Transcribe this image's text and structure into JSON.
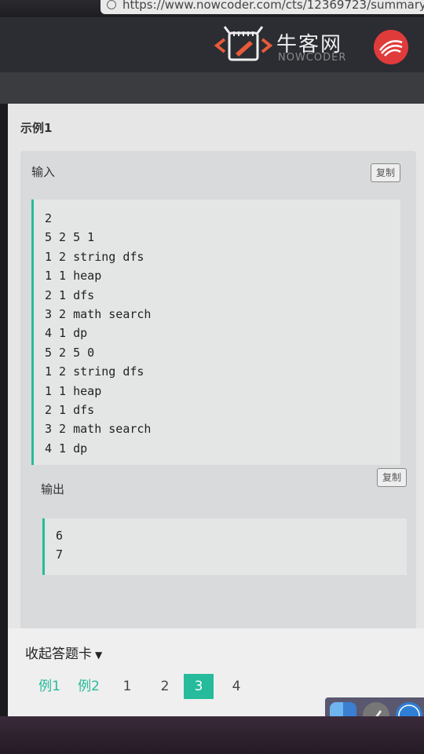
{
  "browser": {
    "url": "https://www.nowcoder.com/cts/12369723/summary"
  },
  "header": {
    "logo_cn": "牛客网",
    "logo_en": "NOWCODER"
  },
  "progress": {
    "fraction": 1.0
  },
  "example": {
    "title": "示例1",
    "input_label": "输入",
    "output_label": "输出",
    "copy_label": "复制",
    "input_lines": [
      "2",
      "5 2 5 1",
      "1 2 string dfs",
      "1 1 heap",
      "2 1 dfs",
      "3 2 math search",
      "4 1 dp",
      "5 2 5 0",
      "1 2 string dfs",
      "1 1 heap",
      "2 1 dfs",
      "3 2 math search",
      "4 1 dp"
    ],
    "output_lines": [
      "6",
      "7"
    ]
  },
  "answer_card": {
    "collapse_label": "收起答题卡",
    "pages": [
      {
        "label": "例1",
        "kind": "example"
      },
      {
        "label": "例2",
        "kind": "example"
      },
      {
        "label": "1",
        "kind": "page"
      },
      {
        "label": "2",
        "kind": "page"
      },
      {
        "label": "3",
        "kind": "active"
      },
      {
        "label": "4",
        "kind": "page"
      }
    ]
  },
  "colors": {
    "accent": "#25bb9b",
    "header_bg": "#2b2d33",
    "brand_red": "#e03b3b"
  }
}
